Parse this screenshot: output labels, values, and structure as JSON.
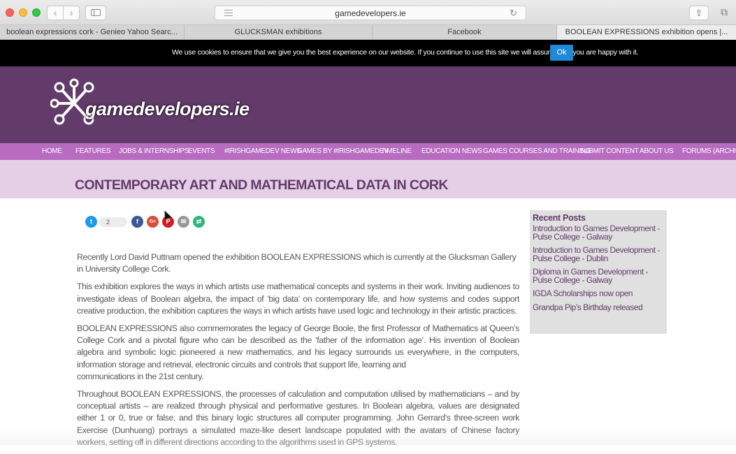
{
  "browser": {
    "url": "gamedevelopers.ie",
    "tabs": [
      {
        "label": "boolean expressions cork - Genieo Yahoo Searc..."
      },
      {
        "label": "GLUCKSMAN exhibitions"
      },
      {
        "label": "Facebook"
      },
      {
        "label": "BOOLEAN EXPRESSIONS exhibition opens |..."
      }
    ]
  },
  "cookie": {
    "text": "We use cookies to ensure that we give you the best experience on our website. If you continue to use this site we will assume that you are happy with it.",
    "ok_label": "Ok"
  },
  "header": {
    "logo_text": "gamedevelopers.ie"
  },
  "menu": {
    "items": [
      {
        "label": "HOME"
      },
      {
        "label": "FEATURES"
      },
      {
        "label": "JOBS & INTERNSHIPS"
      },
      {
        "label": "EVENTS"
      },
      {
        "label": "#IRISHGAMEDEV NEWS"
      },
      {
        "label": "GAMES BY #IRISHGAMEDEV"
      },
      {
        "label": "TIMELINE"
      },
      {
        "label": "EDUCATION NEWS"
      },
      {
        "label": "GAMES COURSES AND TRAINING"
      },
      {
        "label": "SUBMIT CONTENT"
      },
      {
        "label": "ABOUT US"
      },
      {
        "label": "FORUMS (ARCHIVE)"
      }
    ]
  },
  "page": {
    "title": "CONTEMPORARY ART AND MATHEMATICAL DATA IN CORK"
  },
  "share": {
    "twitter_count": "2",
    "icons": [
      "twitter-icon",
      "facebook-icon",
      "google-plus-icon",
      "pinterest-icon",
      "email-icon",
      "more-share-icon"
    ],
    "colors": {
      "twitter": "#1c9be6",
      "facebook": "#3b5998",
      "google": "#dd4b39",
      "pinterest": "#cb2027",
      "email": "#999999",
      "more": "#2eb67d"
    }
  },
  "article": {
    "paragraphs": [
      "Recently Lord David Puttnam opened the exhibition BOOLEAN EXPRESSIONS which is currently at the Glucksman Gallery in University College Cork.",
      "This exhibition explores the ways in which artists use mathematical concepts and systems in their work. Inviting audiences to investigate ideas of Boolean algebra, the impact of ‘big data’ on contemporary life, and how systems and codes support creative production, the exhibition captures the ways in which artists have used logic and technology in their artistic practices.",
      "BOOLEAN EXPRESSIONS also commemorates the legacy of George Boole, the first Professor of Mathematics at Queen’s College Cork and a pivotal figure who can be described as the ‘father of the information age’. His invention of Boolean algebra and symbolic logic pioneered a new mathematics, and his legacy surrounds us everywhere, in the computers, information storage and retrieval, electronic circuits and controls that support life, learning and",
      "communications in the 21st century.",
      "Throughout BOOLEAN EXPRESSIONS, the processes of calculation and computation utilised by mathematicians – and by conceptual artists – are realized through physical and performative gestures. In Boolean algebra, values are designated either 1 or 0, true or false, and this binary logic structures all computer programming. John Gerrard’s three-screen work Exercise (Dunhuang) portrays a simulated maze-like desert landscape populated with the avatars of Chinese factory workers, setting off in different directions according to the algorithms used in GPS systems."
    ]
  },
  "sidebar": {
    "title": "Recent Posts",
    "posts": [
      {
        "label": "Introduction to Games Development - Pulse College - Galway"
      },
      {
        "label": "Introduction to Games Development - Pulse College - Dublin"
      },
      {
        "label": "Diploma in Games Development - Pulse College - Galway"
      },
      {
        "label": "IGDA Scholarships now open"
      },
      {
        "label": "Grandpa Pip’s Birthday released"
      }
    ]
  }
}
